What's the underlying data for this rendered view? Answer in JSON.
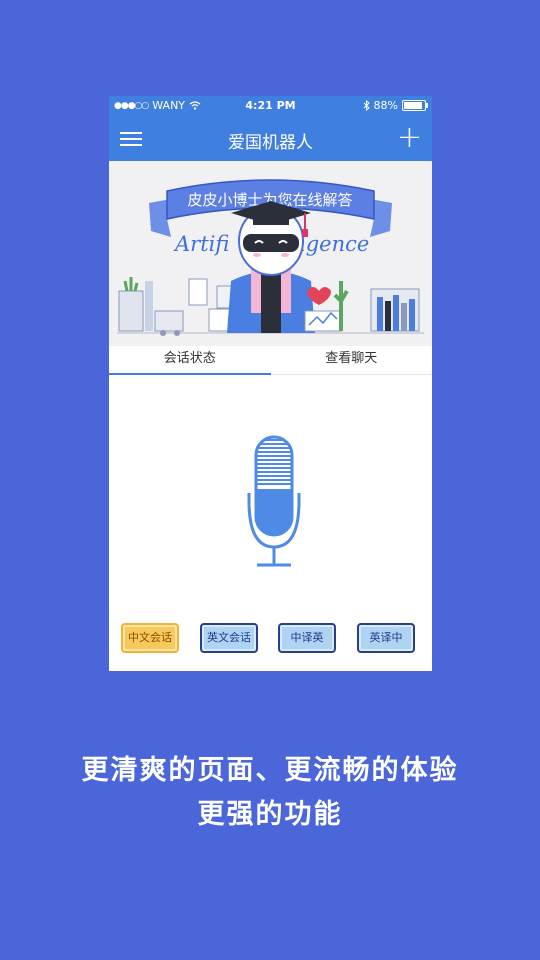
{
  "status_bar": {
    "carrier": "WANY",
    "time": "4:21 PM",
    "battery_text": "88%",
    "battery_level": 0.88
  },
  "header": {
    "title": "爱国机器人",
    "menu_icon": "hamburger-icon",
    "add_icon": "plus-icon"
  },
  "banner": {
    "ribbon_text": "皮皮小博士为您在线解答",
    "word_left": "Artifi",
    "word_right": "igence"
  },
  "tabs": [
    {
      "label": "会话状态",
      "active": true
    },
    {
      "label": "查看聊天",
      "active": false
    }
  ],
  "mic": {
    "icon": "microphone-icon",
    "color": "#4f8ae6"
  },
  "modes": [
    {
      "label": "中文会话",
      "active": true
    },
    {
      "label": "英文会话",
      "active": false
    },
    {
      "label": "中译英",
      "active": false
    },
    {
      "label": "英译中",
      "active": false
    }
  ],
  "captions": {
    "line1": "更清爽的页面、更流畅的体验",
    "line2": "更强的功能"
  },
  "colors": {
    "background": "#4a66d8",
    "primary": "#3f7fe0",
    "active_button": "#f7c85b",
    "button": "#aed3f3"
  }
}
